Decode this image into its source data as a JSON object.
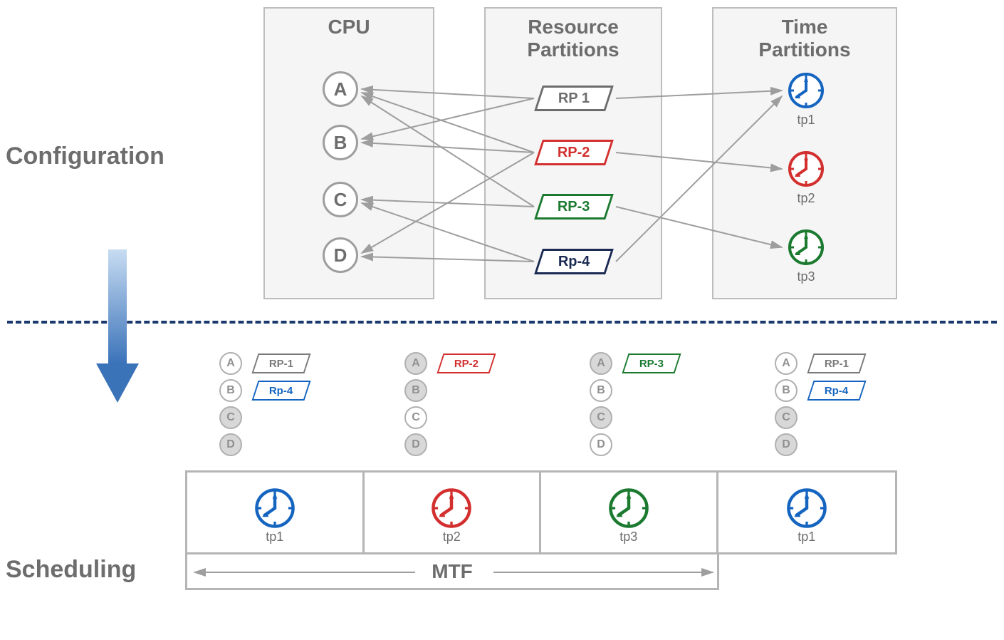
{
  "sections": {
    "configuration": "Configuration",
    "scheduling": "Scheduling"
  },
  "panels": {
    "cpu": "CPU",
    "rp": "Resource\nPartitions",
    "tp": "Time\nPartitions"
  },
  "cpus": [
    "A",
    "B",
    "C",
    "D"
  ],
  "rps": [
    {
      "label": "RP  1",
      "color": "#6d6d6d"
    },
    {
      "label": "RP-2",
      "color": "#d32f2f"
    },
    {
      "label": "RP-3",
      "color": "#1b7a2f"
    },
    {
      "label": "Rp-4",
      "color": "#1a2a52"
    }
  ],
  "tps": [
    {
      "label": "tp1",
      "color": "#1565c0"
    },
    {
      "label": "tp2",
      "color": "#d32f2f"
    },
    {
      "label": "tp3",
      "color": "#1b7a2f"
    }
  ],
  "schedule": [
    {
      "tp": {
        "label": "tp1",
        "color": "#1565c0"
      },
      "cpusFilled": [
        "C",
        "D"
      ],
      "rps": [
        {
          "label": "RP-1",
          "color": "#7a7a7a"
        },
        {
          "label": "Rp-4",
          "color": "#1565c0"
        }
      ]
    },
    {
      "tp": {
        "label": "tp2",
        "color": "#d32f2f"
      },
      "cpusFilled": [
        "A",
        "B",
        "D"
      ],
      "rps": [
        {
          "label": "RP-2",
          "color": "#d32f2f"
        }
      ]
    },
    {
      "tp": {
        "label": "tp3",
        "color": "#1b7a2f"
      },
      "cpusFilled": [
        "A",
        "C"
      ],
      "rps": [
        {
          "label": "RP-3",
          "color": "#1b7a2f"
        }
      ]
    },
    {
      "tp": {
        "label": "tp1",
        "color": "#1565c0"
      },
      "cpusFilled": [
        "C",
        "D"
      ],
      "rps": [
        {
          "label": "RP-1",
          "color": "#7a7a7a"
        },
        {
          "label": "Rp-4",
          "color": "#1565c0"
        }
      ]
    }
  ],
  "mtf": "MTF",
  "chart_data": {
    "type": "diagram",
    "description": "Partitioning configuration and resulting schedule",
    "configuration": {
      "cpus": [
        "A",
        "B",
        "C",
        "D"
      ],
      "resource_partitions": [
        "RP 1",
        "RP-2",
        "RP-3",
        "RP-4"
      ],
      "time_partitions": [
        "tp1",
        "tp2",
        "tp3"
      ],
      "rp_to_cpu": {
        "RP 1": [
          "A",
          "B"
        ],
        "RP-2": [
          "A",
          "B",
          "D"
        ],
        "RP-3": [
          "A",
          "C"
        ],
        "RP-4": [
          "C",
          "D"
        ]
      },
      "rp_to_tp": {
        "RP 1": "tp1",
        "RP-2": "tp2",
        "RP-3": "tp3",
        "RP-4": "tp1"
      }
    },
    "scheduling": {
      "mtf_sequence": [
        "tp1",
        "tp2",
        "tp3",
        "tp1"
      ],
      "slots": [
        {
          "tp": "tp1",
          "active": [
            "RP-1",
            "Rp-4"
          ],
          "idle_cpus": [
            "C",
            "D"
          ]
        },
        {
          "tp": "tp2",
          "active": [
            "RP-2"
          ],
          "idle_cpus": [
            "A",
            "B",
            "D"
          ]
        },
        {
          "tp": "tp3",
          "active": [
            "RP-3"
          ],
          "idle_cpus": [
            "A",
            "C"
          ]
        },
        {
          "tp": "tp1",
          "active": [
            "RP-1",
            "Rp-4"
          ],
          "idle_cpus": [
            "C",
            "D"
          ]
        }
      ]
    }
  }
}
